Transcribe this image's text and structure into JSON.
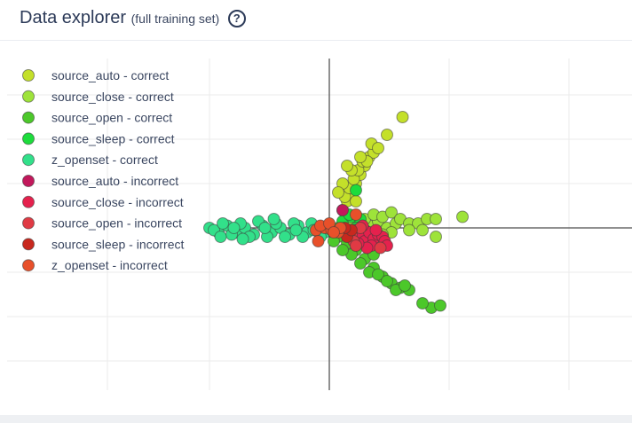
{
  "header": {
    "title": "Data explorer",
    "subtitle": "(full training set)",
    "help_icon": "question-circle-icon"
  },
  "chart_data": {
    "type": "scatter",
    "xlim": [
      -2.7,
      2.5
    ],
    "ylim": [
      -3.7,
      3.8
    ],
    "grid": true,
    "legend_position": "top-left",
    "series": [
      {
        "name": "source_auto - correct",
        "color": "#c4e02a",
        "points": [
          [
            0.3,
            0.4
          ],
          [
            0.4,
            0.6
          ],
          [
            0.5,
            0.8
          ],
          [
            0.6,
            1.0
          ],
          [
            0.7,
            1.2
          ],
          [
            0.8,
            1.4
          ],
          [
            0.9,
            1.6
          ],
          [
            1.0,
            1.7
          ],
          [
            0.35,
            0.7
          ],
          [
            0.45,
            0.9
          ],
          [
            0.55,
            1.1
          ],
          [
            0.65,
            1.3
          ],
          [
            0.75,
            1.5
          ],
          [
            0.85,
            1.5
          ],
          [
            0.95,
            1.9
          ],
          [
            0.3,
            1.0
          ],
          [
            0.5,
            1.3
          ],
          [
            0.7,
            1.6
          ],
          [
            1.1,
            1.8
          ],
          [
            1.3,
            2.1
          ],
          [
            1.65,
            2.5
          ],
          [
            0.4,
            1.4
          ],
          [
            0.2,
            0.8
          ],
          [
            0.6,
            0.6
          ]
        ]
      },
      {
        "name": "source_close - correct",
        "color": "#9ee33a",
        "points": [
          [
            0.5,
            0.05
          ],
          [
            0.7,
            0.1
          ],
          [
            0.9,
            0.05
          ],
          [
            1.1,
            0.15
          ],
          [
            1.3,
            0.0
          ],
          [
            1.5,
            0.1
          ],
          [
            0.8,
            0.2
          ],
          [
            1.0,
            0.3
          ],
          [
            1.2,
            0.25
          ],
          [
            1.4,
            0.35
          ],
          [
            1.6,
            0.2
          ],
          [
            1.8,
            0.1
          ],
          [
            2.0,
            0.1
          ],
          [
            2.2,
            0.2
          ],
          [
            2.4,
            0.2
          ],
          [
            3.0,
            0.25
          ],
          [
            0.6,
            -0.15
          ],
          [
            1.0,
            -0.2
          ],
          [
            1.4,
            -0.1
          ],
          [
            1.8,
            -0.05
          ],
          [
            2.1,
            -0.05
          ],
          [
            2.4,
            -0.2
          ],
          [
            1.2,
            -0.15
          ],
          [
            0.8,
            -0.05
          ]
        ]
      },
      {
        "name": "source_open - correct",
        "color": "#4cc82a",
        "points": [
          [
            0.2,
            -0.2
          ],
          [
            0.4,
            -0.35
          ],
          [
            0.6,
            -0.5
          ],
          [
            0.8,
            -0.7
          ],
          [
            1.0,
            -0.9
          ],
          [
            1.2,
            -1.1
          ],
          [
            1.4,
            -1.25
          ],
          [
            1.6,
            -1.35
          ],
          [
            1.8,
            -1.4
          ],
          [
            0.5,
            -0.6
          ],
          [
            0.7,
            -0.8
          ],
          [
            0.9,
            -1.0
          ],
          [
            1.1,
            -1.05
          ],
          [
            1.3,
            -1.2
          ],
          [
            1.5,
            -1.4
          ],
          [
            1.7,
            -1.3
          ],
          [
            0.3,
            -0.5
          ],
          [
            0.6,
            -0.3
          ],
          [
            1.0,
            -0.6
          ],
          [
            2.3,
            -1.8
          ],
          [
            2.5,
            -1.75
          ],
          [
            2.1,
            -1.7
          ],
          [
            0.2,
            0.0
          ],
          [
            0.1,
            -0.3
          ]
        ]
      },
      {
        "name": "source_sleep - correct",
        "color": "#1ddc3c",
        "points": [
          [
            0.3,
            0.15
          ],
          [
            0.5,
            0.25
          ],
          [
            0.7,
            0.2
          ],
          [
            0.6,
            0.0
          ],
          [
            0.4,
            -0.1
          ],
          [
            0.8,
            -0.05
          ],
          [
            0.6,
            0.85
          ],
          [
            0.45,
            0.3
          ],
          [
            0.55,
            -0.2
          ]
        ]
      },
      {
        "name": "z_openset - correct",
        "color": "#32e08a",
        "points": [
          [
            -2.7,
            0.0
          ],
          [
            -2.5,
            -0.1
          ],
          [
            -2.3,
            0.05
          ],
          [
            -2.1,
            -0.1
          ],
          [
            -1.9,
            0.0
          ],
          [
            -1.7,
            -0.15
          ],
          [
            -1.5,
            0.05
          ],
          [
            -1.3,
            -0.1
          ],
          [
            -1.1,
            0.0
          ],
          [
            -0.9,
            -0.15
          ],
          [
            -0.7,
            0.05
          ],
          [
            -0.5,
            -0.1
          ],
          [
            -0.3,
            0.0
          ],
          [
            -0.1,
            -0.1
          ],
          [
            -2.6,
            -0.05
          ],
          [
            -2.4,
            0.1
          ],
          [
            -2.2,
            -0.15
          ],
          [
            -2.0,
            0.1
          ],
          [
            -1.8,
            -0.2
          ],
          [
            -1.6,
            0.15
          ],
          [
            -1.4,
            -0.2
          ],
          [
            -1.2,
            0.1
          ],
          [
            -1.0,
            -0.2
          ],
          [
            -0.8,
            0.1
          ],
          [
            -0.6,
            -0.2
          ],
          [
            -0.4,
            0.1
          ],
          [
            -0.2,
            -0.2
          ],
          [
            -2.45,
            -0.2
          ],
          [
            -1.25,
            0.2
          ],
          [
            -0.75,
            -0.05
          ],
          [
            -0.35,
            -0.05
          ],
          [
            -1.95,
            -0.25
          ],
          [
            -1.45,
            0.0
          ],
          [
            -2.15,
            0.0
          ]
        ]
      },
      {
        "name": "source_auto - incorrect",
        "color": "#c2185b",
        "points": [
          [
            0.3,
            0.4
          ],
          [
            0.8,
            -0.1
          ]
        ]
      },
      {
        "name": "source_close - incorrect",
        "color": "#e5214d",
        "points": [
          [
            0.6,
            -0.05
          ],
          [
            0.7,
            -0.2
          ],
          [
            0.8,
            -0.3
          ],
          [
            0.9,
            -0.1
          ],
          [
            1.0,
            -0.25
          ],
          [
            0.75,
            0.05
          ],
          [
            0.95,
            -0.4
          ],
          [
            1.1,
            -0.15
          ],
          [
            1.2,
            -0.2
          ],
          [
            0.85,
            -0.45
          ],
          [
            1.25,
            -0.3
          ],
          [
            1.3,
            -0.4
          ],
          [
            1.05,
            -0.05
          ],
          [
            0.65,
            -0.35
          ]
        ]
      },
      {
        "name": "source_open - incorrect",
        "color": "#e03a44",
        "points": [
          [
            0.5,
            -0.15
          ],
          [
            0.55,
            -0.3
          ],
          [
            0.7,
            0.0
          ],
          [
            0.45,
            -0.05
          ],
          [
            0.6,
            -0.4
          ],
          [
            1.15,
            -0.45
          ]
        ]
      },
      {
        "name": "source_sleep - incorrect",
        "color": "#c8281e",
        "points": [
          [
            0.4,
            -0.2
          ],
          [
            0.5,
            -0.05
          ],
          [
            0.35,
            0.0
          ]
        ]
      },
      {
        "name": "z_openset - incorrect",
        "color": "#e8502a",
        "points": [
          [
            -0.3,
            -0.05
          ],
          [
            -0.1,
            0.0
          ],
          [
            0.05,
            -0.05
          ],
          [
            0.2,
            -0.1
          ],
          [
            -0.2,
            0.05
          ],
          [
            0.6,
            0.3
          ],
          [
            -0.25,
            -0.3
          ],
          [
            0.0,
            0.1
          ],
          [
            0.25,
            0.0
          ],
          [
            0.1,
            -0.1
          ]
        ]
      }
    ]
  }
}
